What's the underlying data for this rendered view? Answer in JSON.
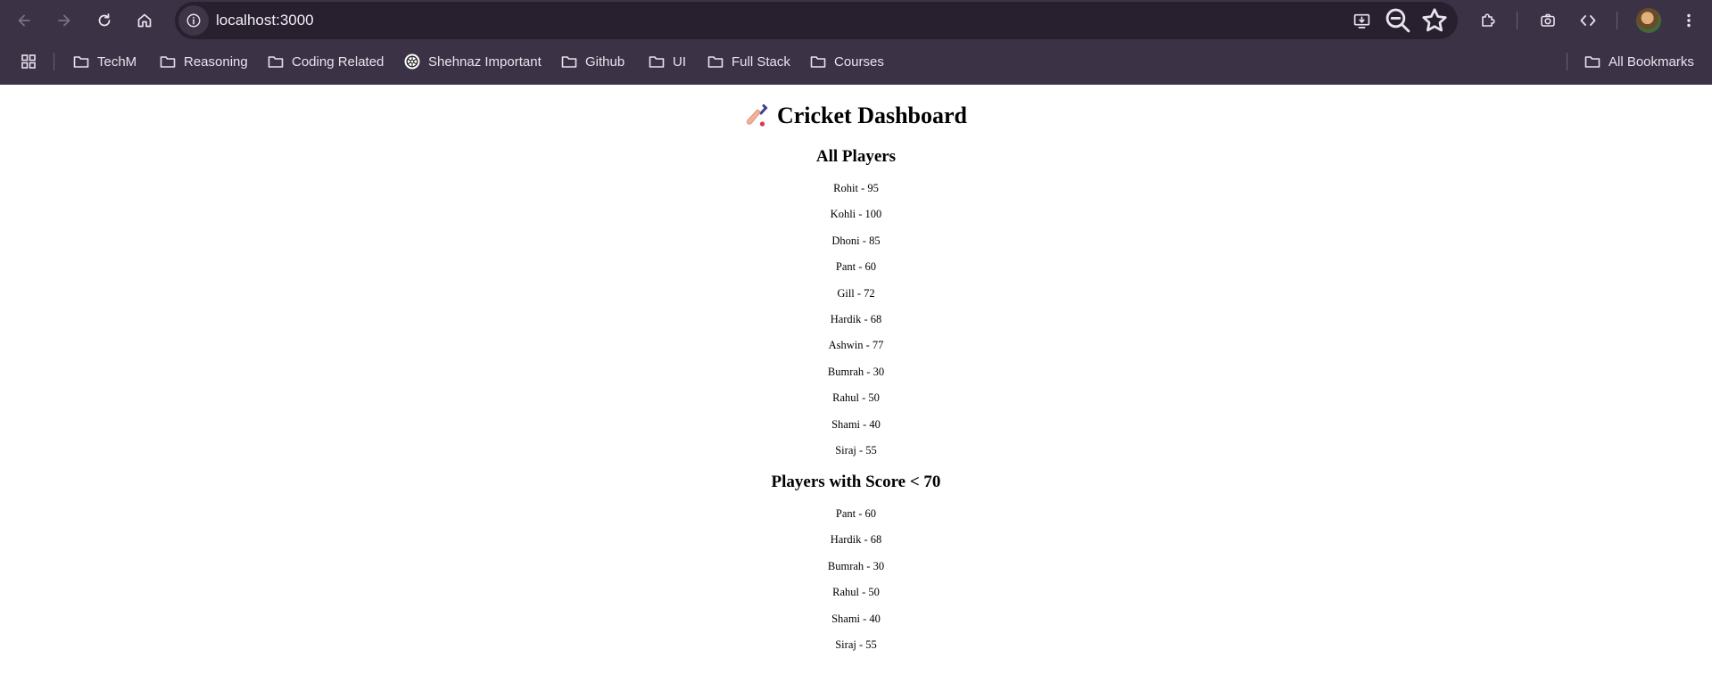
{
  "browser": {
    "url": "localhost:3000",
    "bookmarks": [
      {
        "label": "TechM",
        "icon": "folder-icon"
      },
      {
        "label": "Reasoning",
        "icon": "folder-icon"
      },
      {
        "label": "Coding Related",
        "icon": "folder-icon"
      },
      {
        "label": "Shehnaz Important",
        "icon": "openai-icon"
      },
      {
        "label": "Github",
        "icon": "folder-icon"
      },
      {
        "label": "UI",
        "icon": "folder-icon"
      },
      {
        "label": "Full Stack",
        "icon": "folder-icon"
      },
      {
        "label": "Courses",
        "icon": "folder-icon"
      }
    ],
    "all_bookmarks_label": "All Bookmarks",
    "colors": {
      "frame": "#3b3245",
      "omnibox": "#28202f",
      "text": "#e8e4ee"
    }
  },
  "page": {
    "title": "Cricket Dashboard",
    "title_icon": "cricket-bat-icon",
    "all_players_heading": "All Players",
    "all_players": [
      "Rohit - 95",
      "Kohli - 100",
      "Dhoni - 85",
      "Pant - 60",
      "Gill - 72",
      "Hardik - 68",
      "Ashwin - 77",
      "Bumrah - 30",
      "Rahul - 50",
      "Shami - 40",
      "Siraj - 55"
    ],
    "filtered_heading": "Players with Score < 70",
    "filtered_players": [
      "Pant - 60",
      "Hardik - 68",
      "Bumrah - 30",
      "Rahul - 50",
      "Shami - 40",
      "Siraj - 55"
    ]
  }
}
